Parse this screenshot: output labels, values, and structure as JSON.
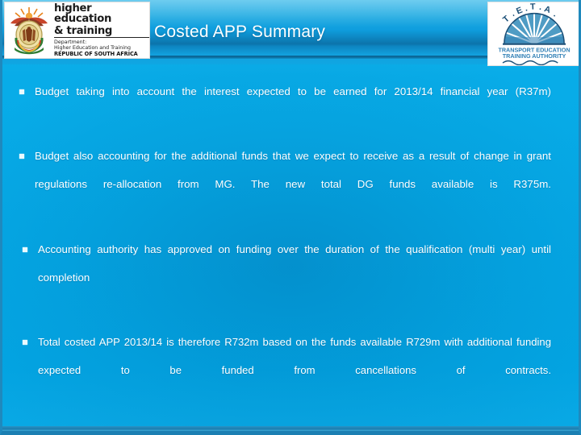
{
  "header": {
    "title": "Costed APP Summary",
    "left_logo": {
      "name": "dhet-logo",
      "line1": "higher education",
      "line2": "& training",
      "line3": "Department:",
      "line4": "Higher Education and Training",
      "line5": "REPUBLIC OF SOUTH AFRICA",
      "emblem": "south-african-coat-of-arms"
    },
    "right_logo": {
      "name": "teta-logo",
      "acronym": "T . E . T . A",
      "line1": "TRANSPORT EDUCATION",
      "line2": "TRAINING AUTHORITY",
      "emblem": "sunburst-fan"
    }
  },
  "bullets": [
    {
      "marker": "square-bullet",
      "text": "Budget taking into account the interest expected to be earned for 2013/14 financial year (R37m)"
    },
    {
      "marker": "square-bullet",
      "text": "Budget also accounting for the additional funds that we expect to receive as a result of change in grant regulations  re-allocation from MG. The new total DG funds available is R375m."
    },
    {
      "marker": "square-bullet",
      "text": "Accounting authority has approved on funding over the duration of the qualification (multi year) until completion"
    },
    {
      "marker": "square-bullet",
      "text": "Total costed APP 2013/14 is therefore R732m based on the funds available R729m with additional funding expected to be funded from cancellations of contracts."
    }
  ],
  "colors": {
    "background_cyan": "#05a9e6",
    "background_center": "#0d86c2",
    "border": "#1f89bd",
    "text": "#ffffff",
    "teta_blue": "#2f7fb5"
  }
}
